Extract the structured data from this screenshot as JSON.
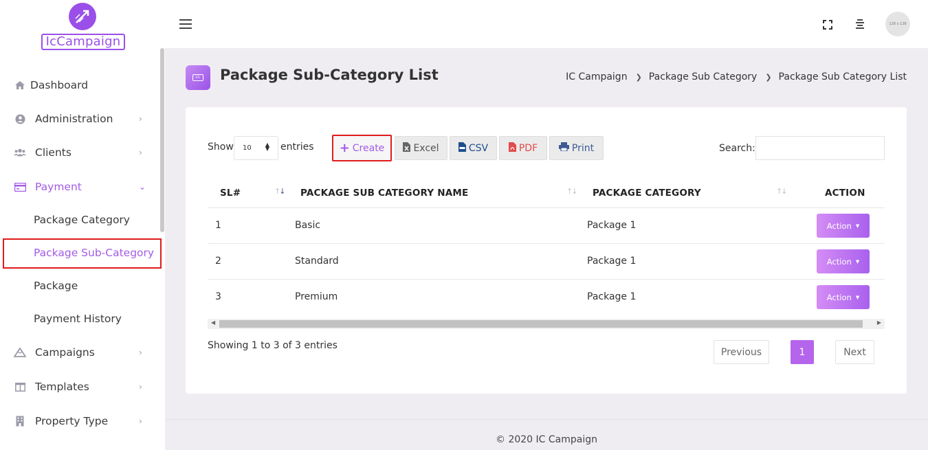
{
  "brand": {
    "name": "IcCampaign"
  },
  "sidebar": {
    "items": [
      {
        "label": "Dashboard",
        "icon": "home-icon"
      },
      {
        "label": "Administration",
        "icon": "user-circle-icon"
      },
      {
        "label": "Clients",
        "icon": "users-icon"
      },
      {
        "label": "Payment",
        "icon": "credit-card-icon"
      },
      {
        "label": "Campaigns",
        "icon": "mountain-icon"
      },
      {
        "label": "Templates",
        "icon": "columns-icon"
      },
      {
        "label": "Property Type",
        "icon": "building-icon"
      }
    ],
    "payment_sub": [
      "Package Category",
      "Package Sub-Category",
      "Package",
      "Payment History"
    ]
  },
  "topbar": {
    "avatar_text": "128 x 128"
  },
  "page": {
    "title": "Package Sub-Category List",
    "icon_text": "CC",
    "breadcrumb": [
      "IC Campaign",
      "Package Sub Category",
      "Package Sub Category List"
    ]
  },
  "toolbar": {
    "show_label": "Show",
    "show_value": "10",
    "entries_label": "entries",
    "create": "Create",
    "excel": "Excel",
    "csv": "CSV",
    "pdf": "PDF",
    "print": "Print",
    "search_label": "Search:"
  },
  "table": {
    "headers": [
      "SL#",
      "PACKAGE SUB CATEGORY NAME",
      "PACKAGE CATEGORY",
      "ACTION"
    ],
    "rows": [
      {
        "sl": "1",
        "name": "Basic",
        "category": "Package 1",
        "action": "Action"
      },
      {
        "sl": "2",
        "name": "Standard",
        "category": "Package 1",
        "action": "Action"
      },
      {
        "sl": "3",
        "name": "Premium",
        "category": "Package 1",
        "action": "Action"
      }
    ]
  },
  "pagination": {
    "info": "Showing 1 to 3 of 3 entries",
    "previous": "Previous",
    "current": "1",
    "next": "Next"
  },
  "footer": {
    "text": "© 2020 IC Campaign"
  },
  "colors": {
    "accent": "#a45be6",
    "highlight": "#e01b1b"
  }
}
